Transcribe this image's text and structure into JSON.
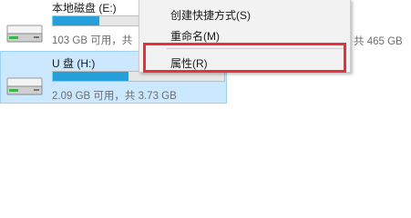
{
  "drives": [
    {
      "name": "本地磁盘 (E:)",
      "info": "103 GB 可用，共",
      "used_fraction": 0.27,
      "selected": false
    },
    {
      "name": "U 盘 (H:)",
      "info": "2.09 GB 可用，共 3.73 GB",
      "used_fraction": 0.44,
      "selected": true
    }
  ],
  "side_info": "共 465 GB",
  "context_menu": {
    "items": [
      {
        "label": "创建快捷方式(S)"
      },
      {
        "label": "重命名(M)"
      },
      {
        "label": "属性(R)"
      }
    ]
  },
  "colors": {
    "bar_fill": "#26a0da",
    "highlight": "#e8303b",
    "selection": "#cce8ff"
  }
}
